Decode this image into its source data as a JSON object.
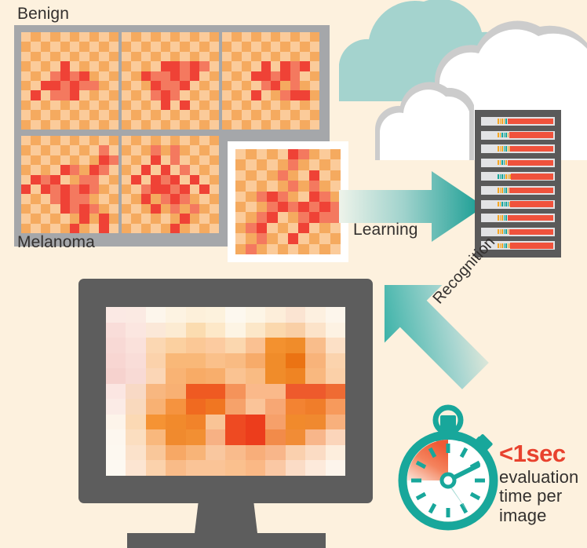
{
  "background_color": "#fdf1de",
  "labels": {
    "benign": "Benign",
    "melanoma": "Melanoma",
    "learning": "Learning",
    "recognition": "Recognition"
  },
  "time_caption": {
    "headline": "<1sec",
    "line1": "evaluation",
    "line2": "time per",
    "line3": "image"
  },
  "colors": {
    "background": "#fdf1de",
    "panel_border": "#a5a7aa",
    "tile_light": "#fbcb9a",
    "tile_dark": "#f5aa5f",
    "lesion_red": "#ef4236",
    "lesion_salmon": "#f4795f",
    "teal": "#18a79b",
    "teal_cloud": "#a4d3ce",
    "cloud_white": "#ffffff",
    "cloud_outline": "#cccccc",
    "dark_gray": "#5d5d5d",
    "text_dark": "#33302e",
    "accent_red": "#e8422e",
    "blade_bg": "#e2e3e5",
    "blade_bar": "#f0523c",
    "led_orange": "#f5a623",
    "led_teal": "#18a79b"
  },
  "dataset": {
    "panel_label_top": "Benign",
    "panel_label_bottom": "Melanoma",
    "tile_grid_size": 10,
    "row_benign_count": 3,
    "row_melanoma_count": 2,
    "featured_tile_label": "featured-sample",
    "tiles": [
      {
        "id": "benign-1",
        "class": "benign",
        "lesion": [
          [
            3,
            4,
            "r"
          ],
          [
            4,
            3,
            "s"
          ],
          [
            4,
            4,
            "r"
          ],
          [
            4,
            5,
            "s"
          ],
          [
            4,
            6,
            "r"
          ],
          [
            5,
            2,
            "r"
          ],
          [
            5,
            3,
            "r"
          ],
          [
            5,
            4,
            "s"
          ],
          [
            5,
            5,
            "r"
          ],
          [
            5,
            6,
            "s"
          ],
          [
            5,
            7,
            "s"
          ],
          [
            6,
            1,
            "r"
          ],
          [
            6,
            3,
            "s"
          ],
          [
            6,
            4,
            "s"
          ],
          [
            6,
            5,
            "r"
          ]
        ]
      },
      {
        "id": "benign-2",
        "class": "benign",
        "lesion": [
          [
            3,
            4,
            "r"
          ],
          [
            3,
            5,
            "r"
          ],
          [
            3,
            6,
            "s"
          ],
          [
            3,
            7,
            "r"
          ],
          [
            3,
            8,
            "s"
          ],
          [
            4,
            2,
            "r"
          ],
          [
            4,
            3,
            "s"
          ],
          [
            4,
            4,
            "s"
          ],
          [
            4,
            5,
            "r"
          ],
          [
            4,
            6,
            "s"
          ],
          [
            4,
            7,
            "r"
          ],
          [
            5,
            3,
            "r"
          ],
          [
            5,
            4,
            "s"
          ],
          [
            5,
            5,
            "s"
          ],
          [
            5,
            6,
            "r"
          ],
          [
            6,
            3,
            "s"
          ],
          [
            6,
            4,
            "r"
          ],
          [
            6,
            5,
            "s"
          ],
          [
            7,
            4,
            "r"
          ],
          [
            7,
            6,
            "r"
          ]
        ]
      },
      {
        "id": "benign-3",
        "class": "benign",
        "lesion": [
          [
            3,
            4,
            "r"
          ],
          [
            3,
            6,
            "r"
          ],
          [
            3,
            7,
            "s"
          ],
          [
            3,
            8,
            "r"
          ],
          [
            4,
            3,
            "r"
          ],
          [
            4,
            4,
            "r"
          ],
          [
            4,
            5,
            "s"
          ],
          [
            4,
            6,
            "r"
          ],
          [
            4,
            7,
            "s"
          ],
          [
            5,
            4,
            "s"
          ],
          [
            5,
            5,
            "r"
          ],
          [
            5,
            7,
            "s"
          ],
          [
            6,
            3,
            "r"
          ],
          [
            6,
            6,
            "s"
          ],
          [
            6,
            7,
            "r"
          ],
          [
            6,
            8,
            "r"
          ]
        ]
      },
      {
        "id": "melanoma-1",
        "class": "melanoma",
        "lesion": [
          [
            1,
            8,
            "s"
          ],
          [
            2,
            8,
            "r"
          ],
          [
            2,
            9,
            "s"
          ],
          [
            3,
            4,
            "r"
          ],
          [
            3,
            5,
            "s"
          ],
          [
            3,
            7,
            "r"
          ],
          [
            3,
            8,
            "s"
          ],
          [
            4,
            1,
            "r"
          ],
          [
            4,
            2,
            "s"
          ],
          [
            4,
            3,
            "r"
          ],
          [
            4,
            6,
            "s"
          ],
          [
            4,
            7,
            "s"
          ],
          [
            5,
            0,
            "r"
          ],
          [
            5,
            2,
            "r"
          ],
          [
            5,
            3,
            "s"
          ],
          [
            5,
            4,
            "r"
          ],
          [
            5,
            5,
            "s"
          ],
          [
            5,
            6,
            "r"
          ],
          [
            5,
            7,
            "s"
          ],
          [
            6,
            3,
            "s"
          ],
          [
            6,
            4,
            "r"
          ],
          [
            6,
            5,
            "s"
          ],
          [
            6,
            6,
            "s"
          ],
          [
            7,
            4,
            "r"
          ],
          [
            7,
            5,
            "s"
          ],
          [
            7,
            6,
            "r"
          ],
          [
            7,
            7,
            "s"
          ],
          [
            8,
            6,
            "r"
          ],
          [
            8,
            8,
            "r"
          ],
          [
            9,
            5,
            "r"
          ],
          [
            9,
            8,
            "r"
          ],
          [
            10,
            4,
            "r"
          ]
        ]
      },
      {
        "id": "melanoma-2",
        "class": "melanoma",
        "lesion": [
          [
            1,
            3,
            "s"
          ],
          [
            1,
            5,
            "s"
          ],
          [
            2,
            3,
            "r"
          ],
          [
            2,
            5,
            "s"
          ],
          [
            3,
            2,
            "r"
          ],
          [
            3,
            4,
            "r"
          ],
          [
            3,
            6,
            "s"
          ],
          [
            4,
            1,
            "r"
          ],
          [
            4,
            3,
            "r"
          ],
          [
            4,
            4,
            "s"
          ],
          [
            4,
            5,
            "r"
          ],
          [
            4,
            7,
            "r"
          ],
          [
            5,
            2,
            "s"
          ],
          [
            5,
            3,
            "r"
          ],
          [
            5,
            4,
            "r"
          ],
          [
            5,
            5,
            "s"
          ],
          [
            5,
            6,
            "r"
          ],
          [
            5,
            8,
            "r"
          ],
          [
            6,
            2,
            "r"
          ],
          [
            6,
            4,
            "s"
          ],
          [
            6,
            5,
            "r"
          ],
          [
            6,
            6,
            "s"
          ],
          [
            7,
            3,
            "r"
          ],
          [
            7,
            5,
            "s"
          ],
          [
            7,
            7,
            "s"
          ],
          [
            8,
            6,
            "r"
          ],
          [
            9,
            5,
            "r"
          ]
        ]
      }
    ],
    "featured": {
      "id": "featured-sample",
      "class": "melanoma",
      "lesion": [
        [
          0,
          5,
          "r"
        ],
        [
          0,
          6,
          "s"
        ],
        [
          1,
          5,
          "s"
        ],
        [
          2,
          4,
          "s"
        ],
        [
          2,
          7,
          "r"
        ],
        [
          3,
          5,
          "s"
        ],
        [
          3,
          7,
          "s"
        ],
        [
          4,
          2,
          "s"
        ],
        [
          4,
          3,
          "r"
        ],
        [
          4,
          4,
          "s"
        ],
        [
          4,
          7,
          "r"
        ],
        [
          4,
          8,
          "s"
        ],
        [
          5,
          3,
          "s"
        ],
        [
          5,
          4,
          "r"
        ],
        [
          5,
          5,
          "s"
        ],
        [
          5,
          6,
          "r"
        ],
        [
          5,
          7,
          "s"
        ],
        [
          5,
          8,
          "r"
        ],
        [
          5,
          9,
          "s"
        ],
        [
          6,
          2,
          "s"
        ],
        [
          6,
          3,
          "r"
        ],
        [
          6,
          6,
          "s"
        ],
        [
          6,
          7,
          "r"
        ],
        [
          6,
          8,
          "s"
        ],
        [
          6,
          9,
          "s"
        ],
        [
          7,
          1,
          "s"
        ],
        [
          7,
          2,
          "r"
        ],
        [
          7,
          6,
          "r"
        ],
        [
          8,
          2,
          "s"
        ],
        [
          8,
          5,
          "r"
        ],
        [
          9,
          1,
          "s"
        ]
      ]
    }
  },
  "server_rack": {
    "name": "server-rack",
    "blade_count": 10,
    "blades": [
      {
        "leds": "ooootoo",
        "bar_width_pct": 62
      },
      {
        "leds": "ootttoo",
        "bar_width_pct": 60
      },
      {
        "leds": "ooottoo",
        "bar_width_pct": 58
      },
      {
        "leds": "oottooo",
        "bar_width_pct": 62
      },
      {
        "leds": "ttttooo",
        "bar_width_pct": 57
      },
      {
        "leds": "ooottoo",
        "bar_width_pct": 60
      },
      {
        "leds": "ootttto",
        "bar_width_pct": 58
      },
      {
        "leds": "ooottto",
        "bar_width_pct": 62
      },
      {
        "leds": "ooottoo",
        "bar_width_pct": 60
      },
      {
        "leds": "ooottoo",
        "bar_width_pct": 59
      }
    ]
  },
  "clouds": [
    {
      "name": "cloud-teal",
      "color": "#a4d3ce"
    },
    {
      "name": "cloud-white-large",
      "color": "#ffffff",
      "outline": "#cccccc"
    },
    {
      "name": "cloud-white-small",
      "color": "#ffffff",
      "outline": "#cccccc"
    }
  ],
  "monitor": {
    "name": "computer-monitor",
    "bezel_color": "#5d5d5d",
    "screen_grid": {
      "cols": 12,
      "rows": 11
    },
    "heatmap": [
      [
        "#fbe9e4",
        "#fbeae3",
        "#fdf6ec",
        "#fdf3e2",
        "#fdf0da",
        "#fdf2dd",
        "#fdf8ef",
        "#fdf5e6",
        "#fdeeda",
        "#fbe4d2",
        "#fdf0e0",
        "#fdf6ec"
      ],
      [
        "#f9ddd9",
        "#fbe6e0",
        "#fbe8d8",
        "#fcebd2",
        "#fbdcb0",
        "#fde8c8",
        "#fdf4e4",
        "#fce7c8",
        "#fbd8ad",
        "#f9cfa6",
        "#fce3c9",
        "#fdf2e3"
      ],
      [
        "#f8d9d5",
        "#fae1db",
        "#fbd7b2",
        "#fbd0a0",
        "#fbc896",
        "#fccba0",
        "#fbd7af",
        "#fac192",
        "#f3912f",
        "#f08c2a",
        "#f9bd8b",
        "#fce0c6"
      ],
      [
        "#f8d6d2",
        "#f9ddd8",
        "#fbd2ab",
        "#f9b878",
        "#f9b878",
        "#fac08a",
        "#f9bb83",
        "#f7ab6a",
        "#f08c2a",
        "#eb7313",
        "#f8b37a",
        "#fbd3ad"
      ],
      [
        "#f6d2ce",
        "#f8dad5",
        "#fbd6b6",
        "#f9b374",
        "#f8ab66",
        "#f8ae6c",
        "#fac392",
        "#f9bb83",
        "#f08c2a",
        "#ef8423",
        "#f9b87f",
        "#fbd0a8"
      ],
      [
        "#fbe6e2",
        "#f8d9c5",
        "#f8b780",
        "#f8b073",
        "#ef5a22",
        "#ef5a22",
        "#f5935a",
        "#fab98a",
        "#fab98a",
        "#ee5a2c",
        "#ee5a2c",
        "#ef6b33"
      ],
      [
        "#fbebe6",
        "#f9d9bd",
        "#f8b173",
        "#f5933f",
        "#f06a20",
        "#f07622",
        "#f6a26a",
        "#fac499",
        "#f7a774",
        "#f38332",
        "#f07d2a",
        "#f79a5c"
      ],
      [
        "#fdf4ea",
        "#fbd9b4",
        "#f59334",
        "#f18a2c",
        "#f1832a",
        "#f9c496",
        "#ee4a22",
        "#ec3d1c",
        "#f6a06a",
        "#f18a2c",
        "#f0892f",
        "#f8b07c"
      ],
      [
        "#fdf7ef",
        "#fbdec0",
        "#f9b87d",
        "#f08a2e",
        "#f28f33",
        "#f7b184",
        "#ee4a22",
        "#ec3d1c",
        "#f28b4a",
        "#f18c36",
        "#f8b68a",
        "#fbd5ba"
      ],
      [
        "#fdf8f0",
        "#fbe2cb",
        "#f9c79a",
        "#f7a865",
        "#f8b478",
        "#f9c79f",
        "#f9bb8c",
        "#f8ae7a",
        "#f8b68a",
        "#fad0ae",
        "#fbdcc4",
        "#fdeedd"
      ],
      [
        "#fdf9f2",
        "#fce5d2",
        "#fbd2ac",
        "#f9bb88",
        "#fac497",
        "#fac497",
        "#fac08e",
        "#fab885",
        "#fac8a4",
        "#fbdcc6",
        "#fdeadb",
        "#fdf5ec"
      ]
    ]
  },
  "stopwatch": {
    "name": "stopwatch",
    "ring_color": "#18a79b",
    "face_color": "#ffffff",
    "wedge_from": "#ef5a35",
    "wedge_to": "#fde9e0",
    "tick_count": 12,
    "hand_color": "#18a79b"
  },
  "arrows": {
    "learning": {
      "name": "learning-arrow",
      "direction": "right",
      "gradient": [
        "#edf2ea",
        "#18a79b"
      ]
    },
    "recognition": {
      "name": "recognition-arrow",
      "direction": "down-left",
      "gradient": [
        "#fdf1de",
        "#18a79b"
      ]
    }
  }
}
